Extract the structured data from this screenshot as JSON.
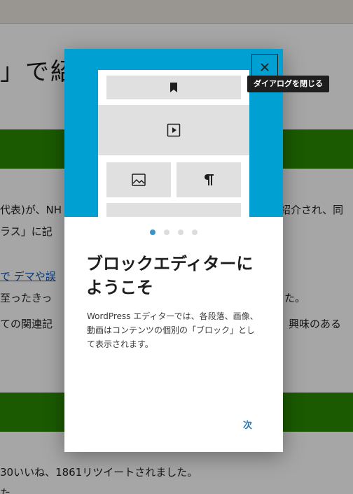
{
  "background": {
    "heading": "」で紹",
    "lines": [
      "代表)が、NH",
      "ラス」に記",
      "で デマや誤",
      "至ったきっ",
      "ての関連記",
      "30いいね、1861リツイートされました。",
      "た"
    ],
    "right_lines": [
      "紹介され、同",
      "た。",
      "興味のある"
    ]
  },
  "modal": {
    "close_label": "×",
    "close_tooltip": "ダイアログを閉じる",
    "title": "ブロックエディターにようこそ",
    "description": "WordPress エディターでは、各段落、画像、動画はコンテンツの個別の「ブロック」として表示されます。",
    "next_label": "次",
    "pages": 4,
    "current_page": 1,
    "mock_icons": [
      "bookmark-icon",
      "video-icon",
      "image-icon",
      "paragraph-icon"
    ]
  },
  "colors": {
    "hero": "#00a0d2",
    "green_band": "#2a8a00",
    "accent": "#3a94c9"
  }
}
